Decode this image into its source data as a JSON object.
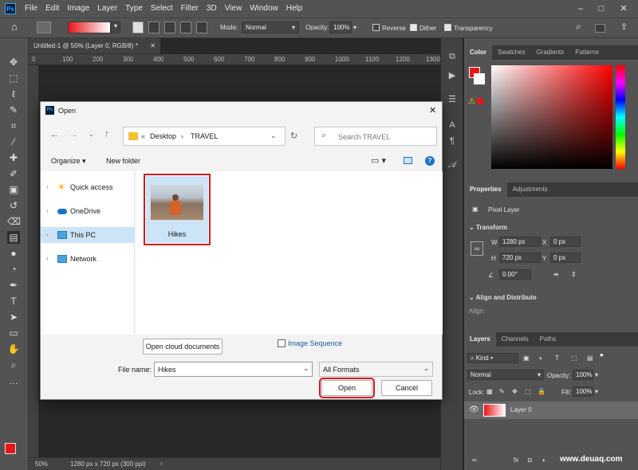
{
  "app": {
    "logo": "Ps",
    "menu": [
      "File",
      "Edit",
      "Image",
      "Layer",
      "Type",
      "Select",
      "Filter",
      "3D",
      "View",
      "Window",
      "Help"
    ],
    "window_controls": [
      "–",
      "□",
      "✕"
    ]
  },
  "options": {
    "mode_label": "Mode:",
    "mode_value": "Normal",
    "opacity_label": "Opacity:",
    "opacity_value": "100%",
    "reverse_label": "Reverse",
    "dither_label": "Dither",
    "transparency_label": "Transparency",
    "gradient_colors": [
      "#e8151a",
      "#ffffff"
    ]
  },
  "document": {
    "tab_title": "Untitled-1 @ 50% (Layer 0, RGB/8) *",
    "ruler_ticks": [
      "0",
      "100",
      "200",
      "300",
      "400",
      "500",
      "600",
      "700",
      "800",
      "900",
      "1000",
      "1100",
      "1200",
      "1300"
    ],
    "zoom": "50%",
    "doc_info": "1280 px x 720 px (300 ppi)"
  },
  "dialog": {
    "title": "Open",
    "ps_icon": "Ps",
    "close": "✕",
    "address_prefix": "«",
    "address": [
      "Desktop",
      "TRAVEL"
    ],
    "search_placeholder": "Search TRAVEL",
    "organize_label": "Organize",
    "new_folder_label": "New folder",
    "nav_items": [
      "Quick access",
      "OneDrive",
      "This PC",
      "Network"
    ],
    "selected_nav": "This PC",
    "file_name": "Hikes",
    "cloud_button": "Open cloud documents",
    "image_sequence_label": "Image Sequence",
    "file_name_label": "File name:",
    "file_name_value": "Hikes",
    "format_value": "All Formats",
    "open_button": "Open",
    "cancel_button": "Cancel"
  },
  "panels": {
    "color_tabs": [
      "Color",
      "Swatches",
      "Gradients",
      "Patterns"
    ],
    "foreground_color": "#e8151a",
    "properties_tabs": [
      "Properties",
      "Adjustments"
    ],
    "pixel_layer_label": "Pixel Layer",
    "transform_label": "Transform",
    "w_label": "W",
    "w_value": "1280 px",
    "h_label": "H",
    "h_value": "720 px",
    "x_label": "X",
    "x_value": "0 px",
    "y_label": "Y",
    "y_value": "0 px",
    "angle_value": "0.00°",
    "align_label": "Align and Distribute",
    "align_sub": "Align:",
    "layers_tabs": [
      "Layers",
      "Channels",
      "Paths"
    ],
    "kind_label": "Kind",
    "blend_mode": "Normal",
    "layer_opacity_label": "Opacity:",
    "layer_opacity_value": "100%",
    "lock_label": "Lock:",
    "fill_label": "Fill:",
    "fill_value": "100%",
    "layer_name": "Layer 0",
    "watermark": "www.deuaq.com"
  }
}
